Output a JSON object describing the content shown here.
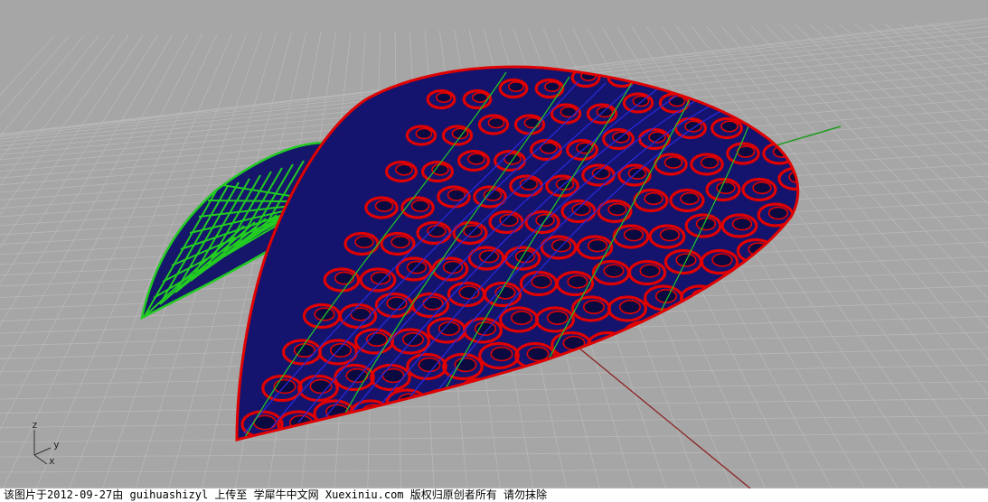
{
  "viewport": {
    "axes": {
      "z": "z",
      "y": "y",
      "x": "x"
    },
    "colors": {
      "background": "#a6a6a6",
      "grid_line": "#b8b8b8",
      "surface_fill": "#14146e",
      "scale_panels": "#e00000",
      "truss_lines": "#22cc22",
      "x_axis": "#8b1a1a",
      "y_axis": "#1f9a1f"
    }
  },
  "footer": {
    "watermark": "该图片于2012-09-27由 guihuashizyl 上传至 学犀牛中文网 Xuexiniu.com 版权归原创者所有 请勿抹除"
  }
}
